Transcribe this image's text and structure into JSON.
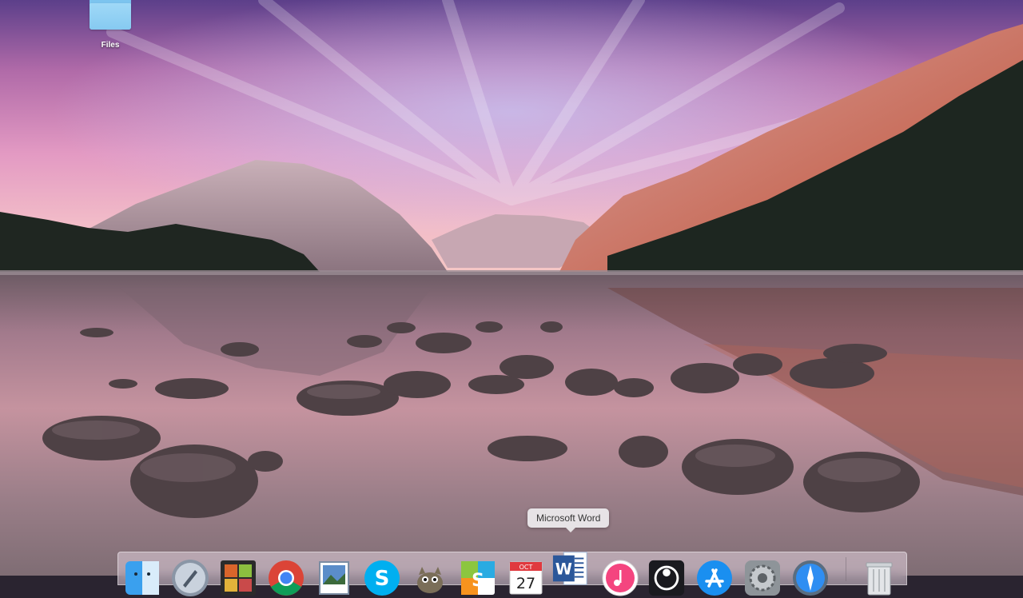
{
  "desktop": {
    "icons": [
      {
        "label": "Files",
        "icon": "folder-icon"
      }
    ]
  },
  "tooltip": {
    "text": "Microsoft Word"
  },
  "dock": {
    "items": [
      {
        "name": "Finder",
        "icon": "finder-icon"
      },
      {
        "name": "Launchpad",
        "icon": "launchpad-icon"
      },
      {
        "name": "Photo Booth",
        "icon": "photo-booth-icon"
      },
      {
        "name": "Google Chrome",
        "icon": "chrome-icon"
      },
      {
        "name": "Preview",
        "icon": "preview-icon"
      },
      {
        "name": "Skype",
        "icon": "skype-icon"
      },
      {
        "name": "GIMP",
        "icon": "gimp-icon"
      },
      {
        "name": "Sketchbook",
        "icon": "sketchbook-icon"
      },
      {
        "name": "Calendar",
        "icon": "calendar-icon"
      },
      {
        "name": "Microsoft Word",
        "icon": "word-icon"
      },
      {
        "name": "iTunes",
        "icon": "itunes-icon"
      },
      {
        "name": "OBS",
        "icon": "obs-icon"
      },
      {
        "name": "App Store",
        "icon": "app-store-icon"
      },
      {
        "name": "System Preferences",
        "icon": "system-preferences-icon"
      },
      {
        "name": "Safari",
        "icon": "safari-icon"
      },
      {
        "name": "Trash",
        "icon": "trash-icon"
      }
    ],
    "calendar": {
      "month": "OCT",
      "day": "27"
    },
    "word_letter": "W",
    "skype_letter": "S",
    "sketchbook_letter": "S"
  },
  "colors": {
    "folder": "#86caf1",
    "dock_bg": "#e1d2de",
    "tooltip_bg": "#eceaec"
  }
}
